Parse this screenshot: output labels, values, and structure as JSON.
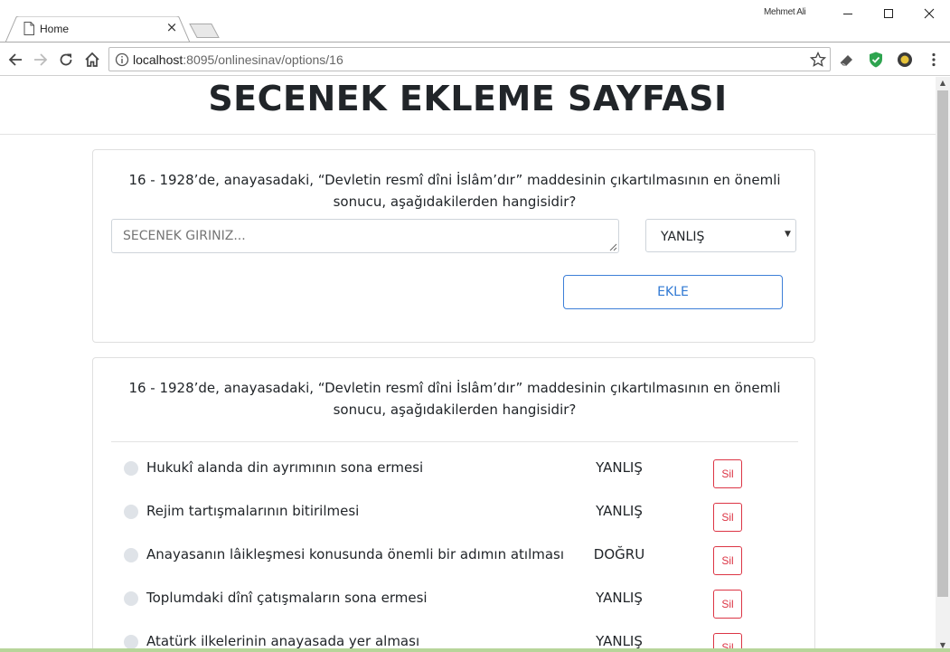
{
  "browser": {
    "tab_title": "Home",
    "profile_name": "Mehmet Ali",
    "url_host": "localhost",
    "url_rest": ":8095/onlinesinav/options/16"
  },
  "page": {
    "title": "SECENEK EKLEME SAYFASI"
  },
  "form": {
    "question": "16 - 1928’de, anayasadaki, “Devletin resmî dîni İslâm’dır” maddesinin çıkartılmasının en önemli sonucu, aşağıdakilerden hangisidir?",
    "option_placeholder": "SECENEK GIRINIZ...",
    "select_value": "YANLIŞ",
    "add_label": "EKLE"
  },
  "list": {
    "question": "16 - 1928’de, anayasadaki, “Devletin resmî dîni İslâm’dır” maddesinin çıkartılmasının en önemli sonucu, aşağıdakilerden hangisidir?",
    "options": [
      {
        "text": "Hukukî alanda din ayrımının sona ermesi",
        "status": "YANLIŞ",
        "delete_label": "Sil"
      },
      {
        "text": "Rejim tartışmalarının bitirilmesi",
        "status": "YANLIŞ",
        "delete_label": "Sil"
      },
      {
        "text": "Anayasanın lâikleşmesi konusunda önemli bir adımın atılması",
        "status": "DOĞRU",
        "delete_label": "Sil"
      },
      {
        "text": "Toplumdaki dînî çatışmaların sona ermesi",
        "status": "YANLIŞ",
        "delete_label": "Sil"
      },
      {
        "text": "Atatürk ilkelerinin anayasada yer alması",
        "status": "YANLIŞ",
        "delete_label": "Sil"
      }
    ]
  },
  "icons": {
    "back": "arrow-left-icon",
    "forward": "arrow-right-icon",
    "reload": "reload-icon",
    "home": "home-icon",
    "info": "info-icon",
    "star": "star-icon",
    "eraser": "eraser-icon",
    "shield": "shield-icon",
    "extension": "bulb-icon",
    "menu": "kebab-menu-icon"
  },
  "colors": {
    "add_button": "#2f78d3",
    "delete_button": "#dc3545",
    "shield": "#2ea44f"
  }
}
